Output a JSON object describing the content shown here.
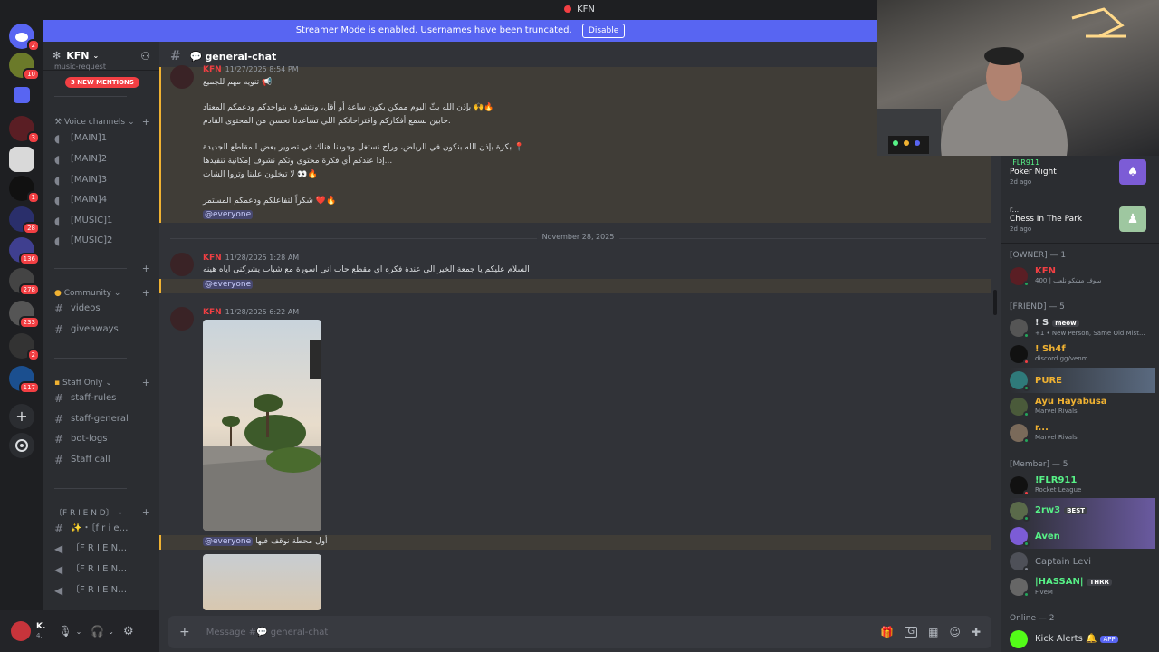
{
  "window": {
    "title": "KFN"
  },
  "banner": {
    "text": "Streamer Mode is enabled. Usernames have been truncated.",
    "button": "Disable"
  },
  "guild_badges": [
    "2",
    "10",
    "3",
    "1",
    "28",
    "136",
    "278",
    "233",
    "2",
    "117"
  ],
  "server": {
    "name": "KFN",
    "mentions_pill": "3 NEW MENTIONS",
    "partial_top_channel": "music-request"
  },
  "categories": {
    "voice": "Voice channels",
    "community": "Community",
    "staff": "Staff Only",
    "friend": "〔F R I E N D〕"
  },
  "voice_channels": [
    "[MAIN]1",
    "[MAIN]2",
    "[MAIN]3",
    "[MAIN]4",
    "[MUSIC]1",
    "[MUSIC]2"
  ],
  "community_channels": [
    "videos",
    "giveaways"
  ],
  "staff_channels": [
    "staff-rules",
    "staff-general",
    "bot-logs",
    "Staff call"
  ],
  "friend_channels": [
    "✨・〔f r i e…",
    "〔F R I E N…",
    "〔F R I E N…",
    "〔F R I E N…"
  ],
  "user": {
    "name": "K.",
    "status": "4."
  },
  "chat": {
    "channel": "general-chat",
    "msg1": {
      "author": "KFN",
      "time": "11/27/2025 8:54 PM",
      "lines": [
        "تنويه مهم للجميع 📢",
        "بإذن الله بثّ اليوم ممكن يكون ساعة أو أقل، ونتشرف بتواجدكم ودعمكم المعتاد 🙌🔥",
        "حابين نسمع أفكاركم واقتراحاتكم اللي تساعدنا نحسن من المحتوى القادم.",
        "بكرة بإذن الله بنكون في الرياض، وراح نستغل وجودنا هناك في تصوير بعض المقاطع الجديدة 📍",
        "إذا عندكم أي فكرة محتوى وتكم نشوف إمكانية تنفيذها...",
        "لا تبخلون علينا وتروا الشات 👀🔥",
        "شكراً لتفاعلكم ودعمكم المستمر ❤️🔥"
      ],
      "ping": "@everyone"
    },
    "date_divider": "November 28, 2025",
    "msg2": {
      "author": "KFN",
      "time": "11/28/2025 1:28 AM",
      "text": "السلام عليكم يا جمعة الخير الي عندة فكره اي مقطع حاب اني اسورة مع شباب يشركني اياه هينه",
      "ping": "@everyone"
    },
    "msg3": {
      "author": "KFN",
      "time": "11/28/2025 6:22 AM",
      "ping": "@everyone",
      "caption": "أول محطة نوقف فيها"
    },
    "composer_placeholder": "Message #💬 general-chat"
  },
  "activities": [
    {
      "title": "Poker Night",
      "time": "2d ago",
      "top": "!FLR911"
    },
    {
      "title": "Chess In The Park",
      "time": "2d ago",
      "top": "r..."
    }
  ],
  "member_groups": {
    "owner": "[OWNER] — 1",
    "friend": "[FRIEND] — 5",
    "member": "[Member] — 5",
    "online": "Online — 2"
  },
  "members": {
    "owner": [
      {
        "name": "KFN",
        "sub": "400 | سوف مشكو نلعب",
        "color": "#f23f43"
      }
    ],
    "friend": [
      {
        "name": "! S",
        "tag": "meow",
        "sub": "+1 • New Person, Same Old Mist...",
        "color": "#dbdee1"
      },
      {
        "name": "! Sh4f",
        "sub": "discord.gg/venm",
        "color": "#f0b232"
      },
      {
        "name": "PURE",
        "sub": "",
        "color": "#f0b232"
      },
      {
        "name": "Ayu Hayabusa",
        "sub": "Marvel Rivals",
        "color": "#f0b232"
      },
      {
        "name": "r...",
        "sub": "Marvel Rivals",
        "color": "#f0b232"
      }
    ],
    "member": [
      {
        "name": "!FLR911",
        "sub": "Rocket League",
        "color": "#57f287"
      },
      {
        "name": "2rw3",
        "tag": "BEST",
        "sub": "",
        "color": "#57f287"
      },
      {
        "name": "Aven",
        "sub": "",
        "color": "#57f287"
      },
      {
        "name": "Captain Levi",
        "sub": "",
        "color": "#949ba4"
      },
      {
        "name": "|HASSAN|",
        "tag": "THRR",
        "sub": "FiveM",
        "color": "#57f287"
      }
    ],
    "online": [
      {
        "name": "Kick Alerts",
        "tag": "APP",
        "sub": "",
        "color": "#dbdee1"
      }
    ]
  },
  "colors": {
    "blurple": "#5865f2",
    "red": "#f23f43",
    "gold": "#f0b232",
    "green": "#23a55a"
  }
}
